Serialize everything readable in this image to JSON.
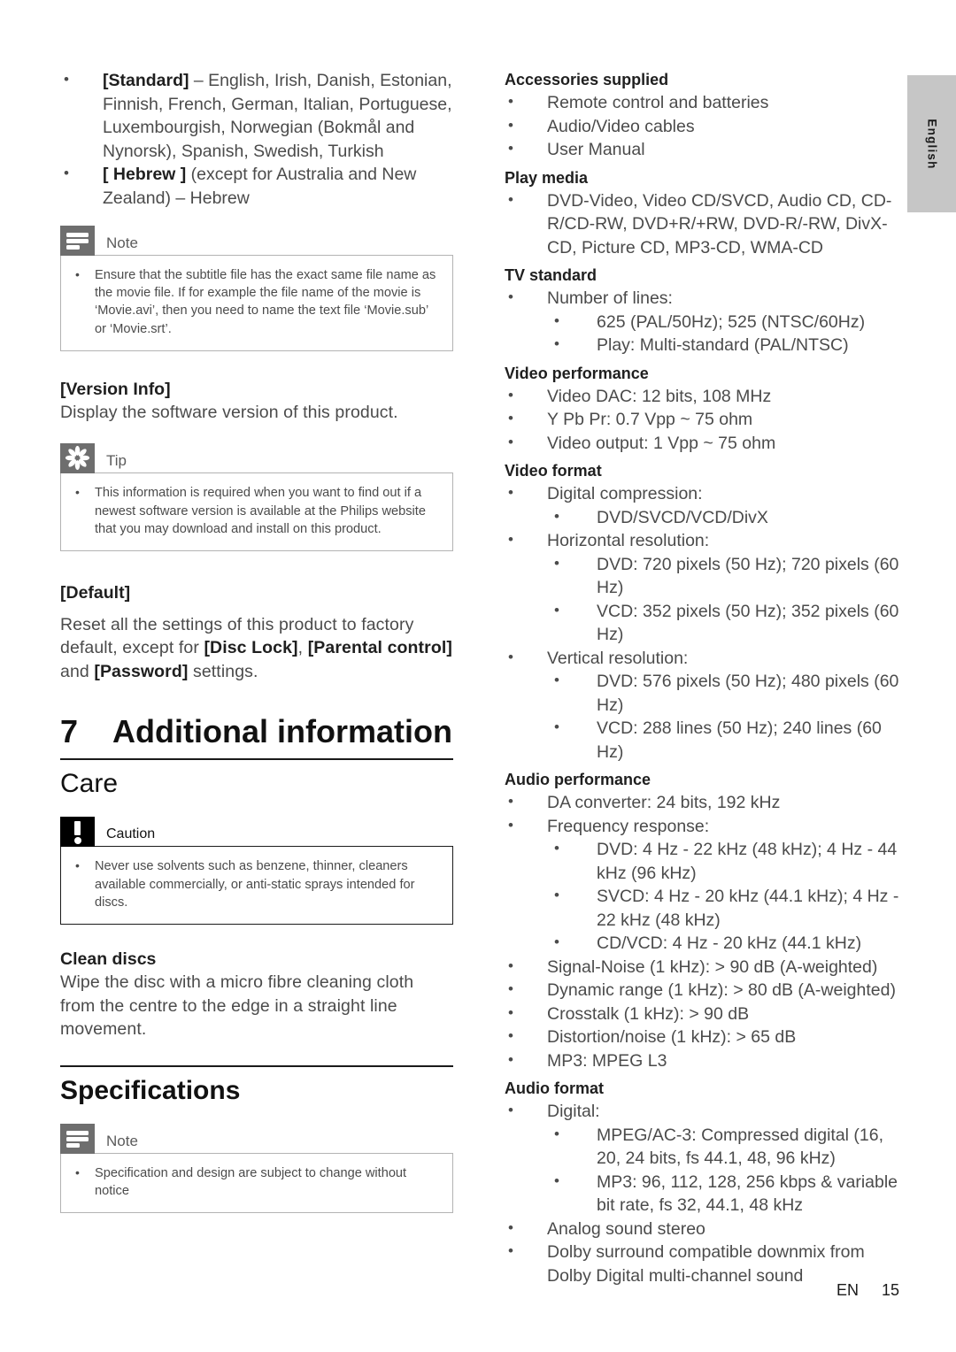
{
  "side_tab": {
    "label": "English"
  },
  "footer": {
    "lang": "EN",
    "page": "15"
  },
  "left_column": {
    "language_list": [
      {
        "bold": "[Standard]",
        "rest": " – English, Irish, Danish, Estonian, Finnish, French, German, Italian, Portuguese, Luxembourgish, Norwegian (Bokmål and Nynorsk), Spanish, Swedish, Turkish"
      },
      {
        "bold": "[ Hebrew ]",
        "rest": " (except for Australia and New Zealand) – Hebrew"
      }
    ],
    "note1": {
      "title": "Note",
      "icon": "note-icon",
      "items": [
        "Ensure that the subtitle file has the exact same file name as the movie file. If for example the file name of the movie is ‘Movie.avi’, then you need to name the text file ‘Movie.sub’ or ‘Movie.srt’."
      ]
    },
    "version_info": {
      "heading": "[Version Info]",
      "text": "Display the software version of this product."
    },
    "tip1": {
      "title": "Tip",
      "icon": "tip-icon",
      "items": [
        "This information is required when you want to find out if a newest software version is available at the Philips website that you may download and install on this product."
      ]
    },
    "default": {
      "heading": "[Default]",
      "text_1": "Reset all the settings of this product to factory default, except for ",
      "bold_1": "[Disc Lock]",
      "text_2": ", ",
      "bold_2": "[Parental control]",
      "text_3": " and ",
      "bold_3": "[Password]",
      "text_4": " settings."
    },
    "chapter": {
      "number": "7",
      "title": "Additional information"
    },
    "care": {
      "heading": "Care",
      "caution": {
        "title": "Caution",
        "icon": "caution-icon",
        "items": [
          "Never use solvents such as benzene, thinner, cleaners available commercially, or anti-static sprays intended for discs."
        ]
      },
      "clean_discs_heading": "Clean discs",
      "clean_discs_text": "Wipe the disc with a micro fibre cleaning cloth from the centre to the edge in a straight line movement."
    },
    "specifications": {
      "heading": "Specifications",
      "note": {
        "title": "Note",
        "icon": "note-icon",
        "items": [
          "Specification and design are subject to change without notice"
        ]
      }
    }
  },
  "right_column": {
    "sections": [
      {
        "heading": "Accessories supplied",
        "items": [
          {
            "text": "Remote control and batteries"
          },
          {
            "text": "Audio/Video cables"
          },
          {
            "text": "User Manual"
          }
        ]
      },
      {
        "heading": "Play media",
        "items": [
          {
            "text": "DVD-Video, Video CD/SVCD, Audio CD, CD-R/CD-RW, DVD+R/+RW, DVD-R/-RW, DivX-CD, Picture CD, MP3-CD, WMA-CD"
          }
        ]
      },
      {
        "heading": "TV standard",
        "items": [
          {
            "text": "Number of lines:",
            "sub": [
              "625 (PAL/50Hz); 525 (NTSC/60Hz)",
              "Play: Multi-standard (PAL/NTSC)"
            ]
          }
        ]
      },
      {
        "heading": "Video performance",
        "items": [
          {
            "text": "Video DAC: 12 bits, 108 MHz"
          },
          {
            "text": "Y Pb Pr: 0.7 Vpp ~ 75 ohm"
          },
          {
            "text": "Video output: 1 Vpp ~ 75 ohm"
          }
        ]
      },
      {
        "heading": "Video format",
        "items": [
          {
            "text": "Digital compression:",
            "sub": [
              "DVD/SVCD/VCD/DivX"
            ]
          },
          {
            "text": "Horizontal resolution:",
            "sub": [
              "DVD: 720 pixels (50 Hz); 720 pixels (60 Hz)",
              "VCD: 352 pixels (50 Hz); 352 pixels (60 Hz)"
            ]
          },
          {
            "text": "Vertical resolution:",
            "sub": [
              "DVD: 576 pixels (50 Hz); 480 pixels (60 Hz)",
              "VCD: 288 lines (50 Hz); 240 lines (60 Hz)"
            ]
          }
        ]
      },
      {
        "heading": "Audio performance",
        "items": [
          {
            "text": "DA converter: 24 bits, 192 kHz"
          },
          {
            "text": "Frequency response:",
            "sub": [
              "DVD: 4 Hz - 22 kHz (48 kHz); 4 Hz - 44 kHz (96 kHz)",
              "SVCD: 4 Hz - 20 kHz (44.1 kHz); 4 Hz - 22 kHz (48 kHz)",
              "CD/VCD: 4 Hz - 20 kHz (44.1 kHz)"
            ]
          },
          {
            "text": "Signal-Noise (1 kHz): > 90 dB (A-weighted)"
          },
          {
            "text": "Dynamic range (1 kHz): > 80 dB (A-weighted)"
          },
          {
            "text": "Crosstalk (1 kHz): > 90 dB"
          },
          {
            "text": "Distortion/noise (1 kHz): > 65 dB"
          },
          {
            "text": "MP3: MPEG L3"
          }
        ]
      },
      {
        "heading": "Audio format",
        "items": [
          {
            "text": "Digital:",
            "sub": [
              "MPEG/AC-3: Compressed digital (16, 20, 24 bits, fs 44.1, 48, 96 kHz)",
              "MP3: 96, 112, 128, 256 kbps & variable bit rate, fs 32, 44.1, 48 kHz"
            ]
          },
          {
            "text": "Analog sound stereo"
          },
          {
            "text": "Dolby surround compatible downmix from Dolby Digital multi-channel sound"
          }
        ]
      }
    ]
  }
}
